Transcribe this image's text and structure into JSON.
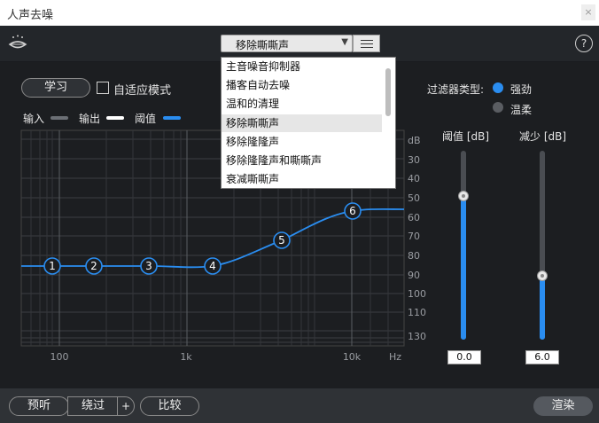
{
  "window": {
    "title": "人声去噪",
    "close_glyph": "×"
  },
  "header": {
    "preset_value": "移除嘶嘶声",
    "help_glyph": "?"
  },
  "dropdown": {
    "items": [
      "主音噪音抑制器",
      "播客自动去噪",
      "温和的清理",
      "移除嘶嘶声",
      "移除隆隆声",
      "移除隆隆声和嘶嘶声",
      "衰减嘶嘶声"
    ],
    "selected_index": 3
  },
  "controls": {
    "learn_label": "学习",
    "adaptive_label": "自适应模式",
    "adaptive_checked": false
  },
  "legend": {
    "input_label": "输入",
    "output_label": "输出",
    "threshold_label": "阈值",
    "input_color": "#6b6f75",
    "output_color": "#ffffff",
    "threshold_color": "#2a8df0"
  },
  "chart_data": {
    "type": "line",
    "y_ticks": [
      "dB",
      "30",
      "40",
      "50",
      "60",
      "70",
      "80",
      "90",
      "100",
      "110",
      "130"
    ],
    "x_ticks": [
      "100",
      "1k",
      "10k",
      "Hz"
    ],
    "nodes": [
      {
        "label": "1"
      },
      {
        "label": "2"
      },
      {
        "label": "3"
      },
      {
        "label": "4"
      },
      {
        "label": "5"
      },
      {
        "label": "6"
      }
    ]
  },
  "filter": {
    "type_label": "过滤器类型:",
    "strong_label": "强劲",
    "gentle_label": "温柔",
    "selected": "强劲"
  },
  "sliders": {
    "threshold": {
      "label": "阈值 [dB]",
      "value": "0.0",
      "fraction": 0.76
    },
    "reduction": {
      "label": "减少 [dB]",
      "value": "6.0",
      "fraction": 0.34
    }
  },
  "footer": {
    "preview_label": "预听",
    "bypass_label": "绕过",
    "plus_label": "+",
    "compare_label": "比较",
    "render_label": "渲染"
  }
}
